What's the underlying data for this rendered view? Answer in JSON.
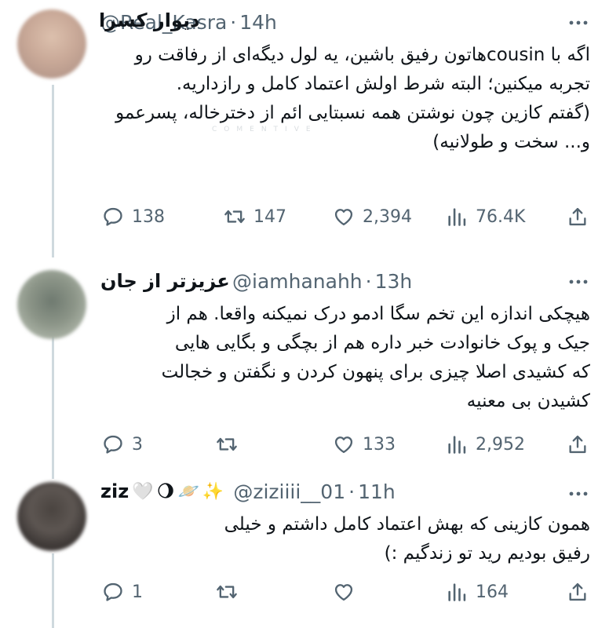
{
  "tweets": [
    {
      "name": "دیوار کسرا",
      "handle": "@Real_Kasra",
      "separator": "·",
      "time": "14h",
      "body": "اگه با cousinهاتون رفیق باشین، یه لول دیگه‌ای از رفاقت رو تجربه میکنین؛ البته شرط اولش اعتماد کامل و رازداریه.\n(گفتم کازین چون نوشتن همه نسبتایی ائم از دخترخاله، پسرعمو و... سخت و طولانیه)",
      "watermark": "COMENTIVE",
      "replies": "138",
      "retweets": "147",
      "likes": "2,394",
      "views": "76.4K"
    },
    {
      "name": "عزیزتر از جان",
      "handle": "@iamhanahh",
      "separator": "·",
      "time": "13h",
      "body": "هیچکی اندازه این تخم سگا ادمو درک نمیکنه واقعا. هم از جیک و پوک خانوادت خبر داره هم از بچگی و بگایی هایی که کشیدی اصلا چیزی برای پنهون کردن و نگفتن و خجالت کشیدن بی معنیه",
      "replies": "3",
      "retweets": "",
      "likes": "133",
      "views": "2,952"
    },
    {
      "name": "ziz",
      "name_emojis": [
        "🤍",
        "🌖",
        "🪐",
        "✨"
      ],
      "handle": "@ziziiii__01",
      "separator": "·",
      "time": "11h",
      "body": "همون کازینی که بهش اعتماد کامل داشتم و خیلی رفیق بودیم رید تو زندگیم :)",
      "replies": "1",
      "retweets": "",
      "likes": "",
      "views": "164"
    }
  ],
  "icons": {
    "more": "more-horizontal-icon",
    "reply": "reply-icon",
    "retweet": "retweet-icon",
    "like": "heart-icon",
    "views": "views-icon",
    "share": "share-icon"
  },
  "colors": {
    "text": "#0f1419",
    "secondary": "#536471",
    "thread_line": "#cfd9de"
  }
}
